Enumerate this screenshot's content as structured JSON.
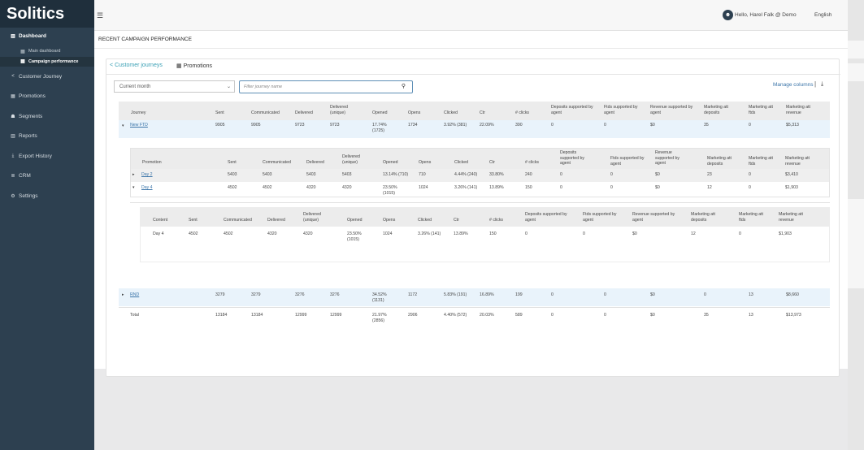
{
  "app": {
    "logo": "Solitics"
  },
  "sidebar": {
    "items": [
      {
        "label": "Dashboard",
        "icon": "bar-chart-icon",
        "active": true
      },
      {
        "label": "Main dashboard",
        "icon": "grid-icon"
      },
      {
        "label": "Campaign performance",
        "icon": "grid-icon",
        "active": true
      },
      {
        "label": "Customer Journey",
        "icon": "share-icon"
      },
      {
        "label": "Promotions",
        "icon": "grid-icon"
      },
      {
        "label": "Segments",
        "icon": "users-icon"
      },
      {
        "label": "Reports",
        "icon": "bar-chart-icon"
      },
      {
        "label": "Export History",
        "icon": "download-icon"
      },
      {
        "label": "CRM",
        "icon": "list-icon"
      },
      {
        "label": "Settings",
        "icon": "gears-icon"
      }
    ]
  },
  "topbar": {
    "user": "Hello, Harel Falk @ Demo",
    "avatar": "☻",
    "lang": "English"
  },
  "main": {
    "title": "RECENT CAMPAIGN PERFORMANCE",
    "tabs": [
      {
        "label": "Customer journeys"
      },
      {
        "label": "Promotions"
      }
    ],
    "period": "Current month",
    "search_placeholder": "Filter journey name",
    "manage": "Manage columns",
    "sep": "|"
  },
  "table": {
    "headers": [
      "Journey",
      "Sent",
      "Communicated",
      "Delivered",
      "Delivered (unique)",
      "Opened",
      "Opens",
      "Clicked",
      "Ctr",
      "# clicks",
      "Deposits supported by agent",
      "Ftds supported by agent",
      "Revenue supported by agent",
      "Marketing att deposits",
      "Marketing att ftds",
      "Marketing att revenue"
    ],
    "rows": {
      "newftd": [
        "New FTD",
        "9905",
        "9905",
        "9723",
        "9723",
        "17.74% (1725)",
        "1734",
        "3.92% (381)",
        "22.09%",
        "390",
        "0",
        "0",
        "$0",
        "35",
        "0",
        "$5,313"
      ],
      "rnd": [
        "RND",
        "3279",
        "3279",
        "3276",
        "3276",
        "34.52% (1131)",
        "1172",
        "5.83% (191)",
        "16.89%",
        "199",
        "0",
        "0",
        "$0",
        "0",
        "13",
        "$8,660"
      ],
      "total": [
        "Total",
        "",
        "13184",
        "13184",
        "12999",
        "12999",
        "21.97% (2856)",
        "2906",
        "4.40% (572)",
        "20.03%",
        "589",
        "0",
        "0",
        "$0",
        "35",
        "13",
        "$13,973"
      ]
    }
  },
  "promo": {
    "headers": [
      "Promotion",
      "Sent",
      "Communicated",
      "Delivered",
      "Delivered (unique)",
      "Opened",
      "Opens",
      "Clicked",
      "Ctr",
      "# clicks",
      "Deposits supported by agent",
      "Ftds supported by agent",
      "Revenue supported by agent",
      "Marketing att deposits",
      "Marketing att ftds",
      "Marketing att revenue"
    ],
    "rows": {
      "day2": [
        "Day 2",
        "5403",
        "5403",
        "5403",
        "5403",
        "13.14% (710)",
        "710",
        "4.44% (240)",
        "33.80%",
        "240",
        "0",
        "0",
        "$0",
        "23",
        "0",
        "$3,410"
      ],
      "day4": [
        "Day 4",
        "4502",
        "4502",
        "4320",
        "4320",
        "23.50% (1015)",
        "1024",
        "3.26% (141)",
        "13.89%",
        "150",
        "0",
        "0",
        "$0",
        "12",
        "0",
        "$1,903"
      ]
    }
  },
  "content": {
    "headers": [
      "Content",
      "Sent",
      "Communicated",
      "Delivered",
      "Delivered (unique)",
      "Opened",
      "Opens",
      "Clicked",
      "Ctr",
      "# clicks",
      "Deposits supported by agent",
      "Ftds supported by agent",
      "Revenue supported by agent",
      "Marketing att deposits",
      "Marketing att ftds",
      "Marketing att revenue"
    ],
    "row": [
      "Day 4",
      "4502",
      "4502",
      "4320",
      "4320",
      "23.50% (1015)",
      "1024",
      "3.26% (141)",
      "13.89%",
      "150",
      "0",
      "0",
      "$0",
      "12",
      "0",
      "$1,903"
    ]
  }
}
